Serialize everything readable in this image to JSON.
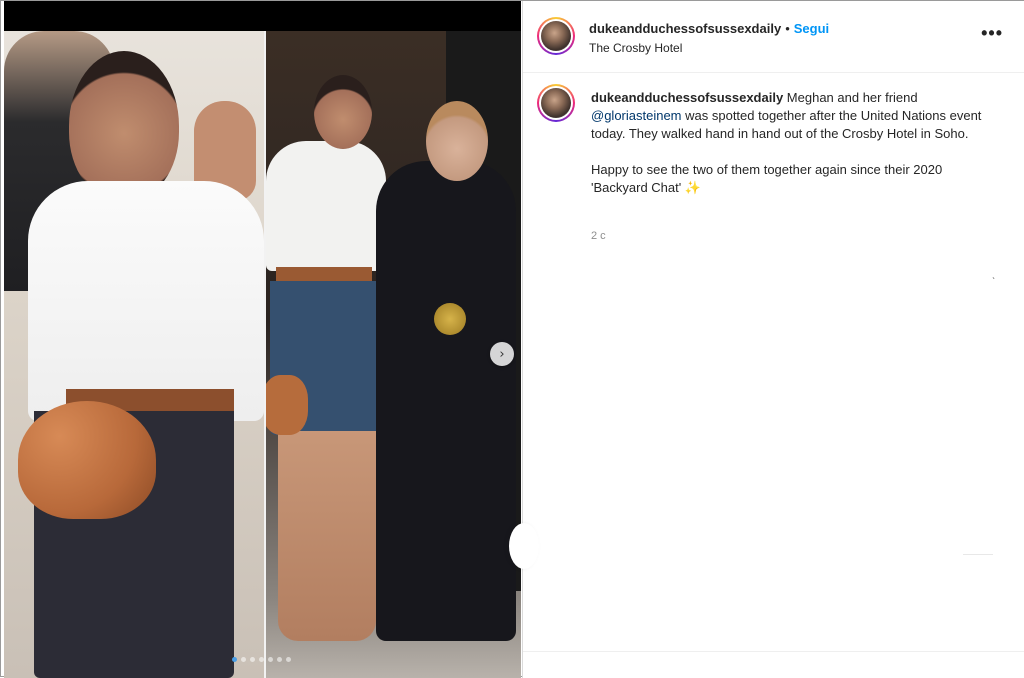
{
  "post": {
    "username": "dukeandduchessofsussexdaily",
    "follow_label": "Segui",
    "separator": "•",
    "location": "The Crosby Hotel",
    "more_label": "•••",
    "caption": {
      "author": "dukeandduchessofsussexdaily",
      "text_before_mention": " Meghan and her friend ",
      "mention": "@gloriasteinem",
      "text_after_mention": " was spotted together after the United Nations event today. They walked hand in hand out of the Crosby Hotel in Soho.",
      "paragraph_2": "Happy to see the two of them together again since their 2020 'Backyard Chat' ✨"
    },
    "timestamp": "2 с",
    "next_icon": "›"
  },
  "carousel": {
    "total": 7,
    "active_index": 0
  },
  "colors": {
    "follow": "#0095f6",
    "mention": "#00376b",
    "dot_active": "#4a9fe8"
  }
}
